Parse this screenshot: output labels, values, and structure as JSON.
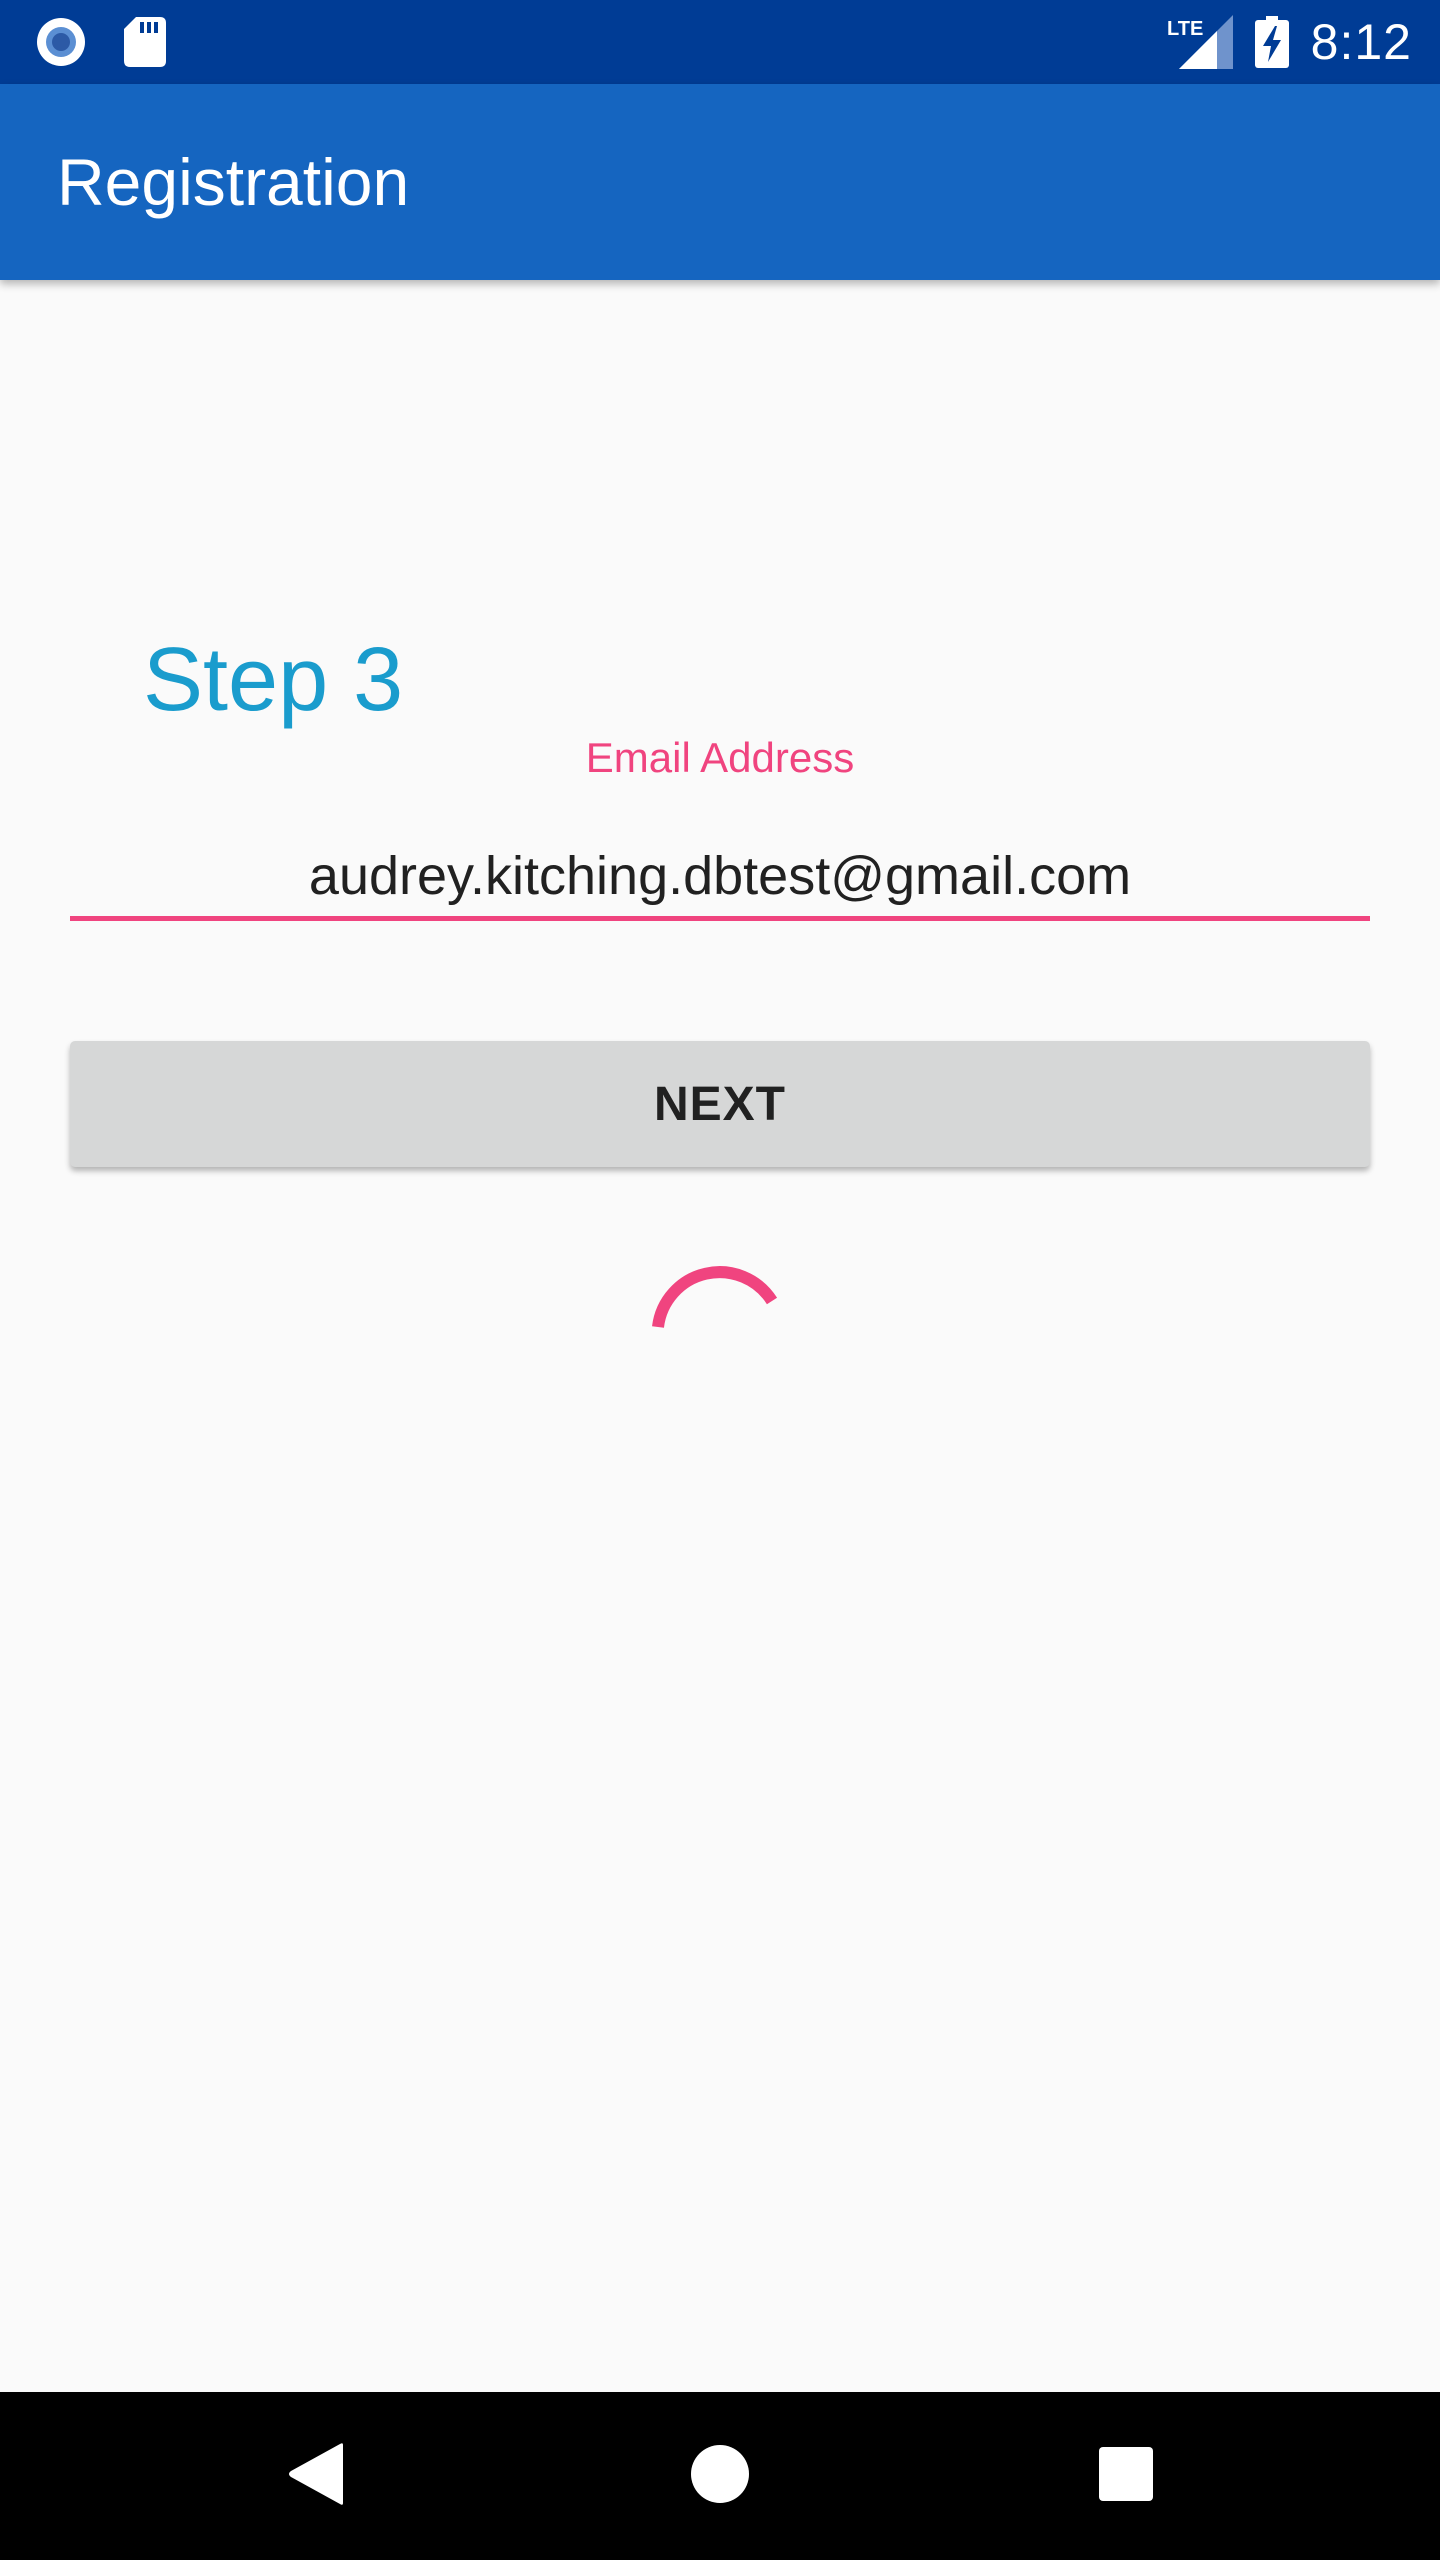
{
  "status_bar": {
    "time": "8:12",
    "network_label": "LTE",
    "icons": [
      "record-icon",
      "sd-card-icon",
      "lte-signal-icon",
      "battery-charging-icon"
    ]
  },
  "app_bar": {
    "title": "Registration"
  },
  "form": {
    "step_title": "Step 3",
    "email_label": "Email Address",
    "email_value": "audrey.kitching.dbtest@gmail.com",
    "next_label": "NEXT"
  },
  "nav_bar": {
    "icons": [
      "back-icon",
      "home-icon",
      "recents-icon"
    ]
  },
  "colors": {
    "status_bar": "#003c95",
    "app_bar": "#1565c0",
    "accent": "#f0447f",
    "step_title": "#1a9ccd",
    "button": "#d6d7d7",
    "background": "#fafafa"
  }
}
